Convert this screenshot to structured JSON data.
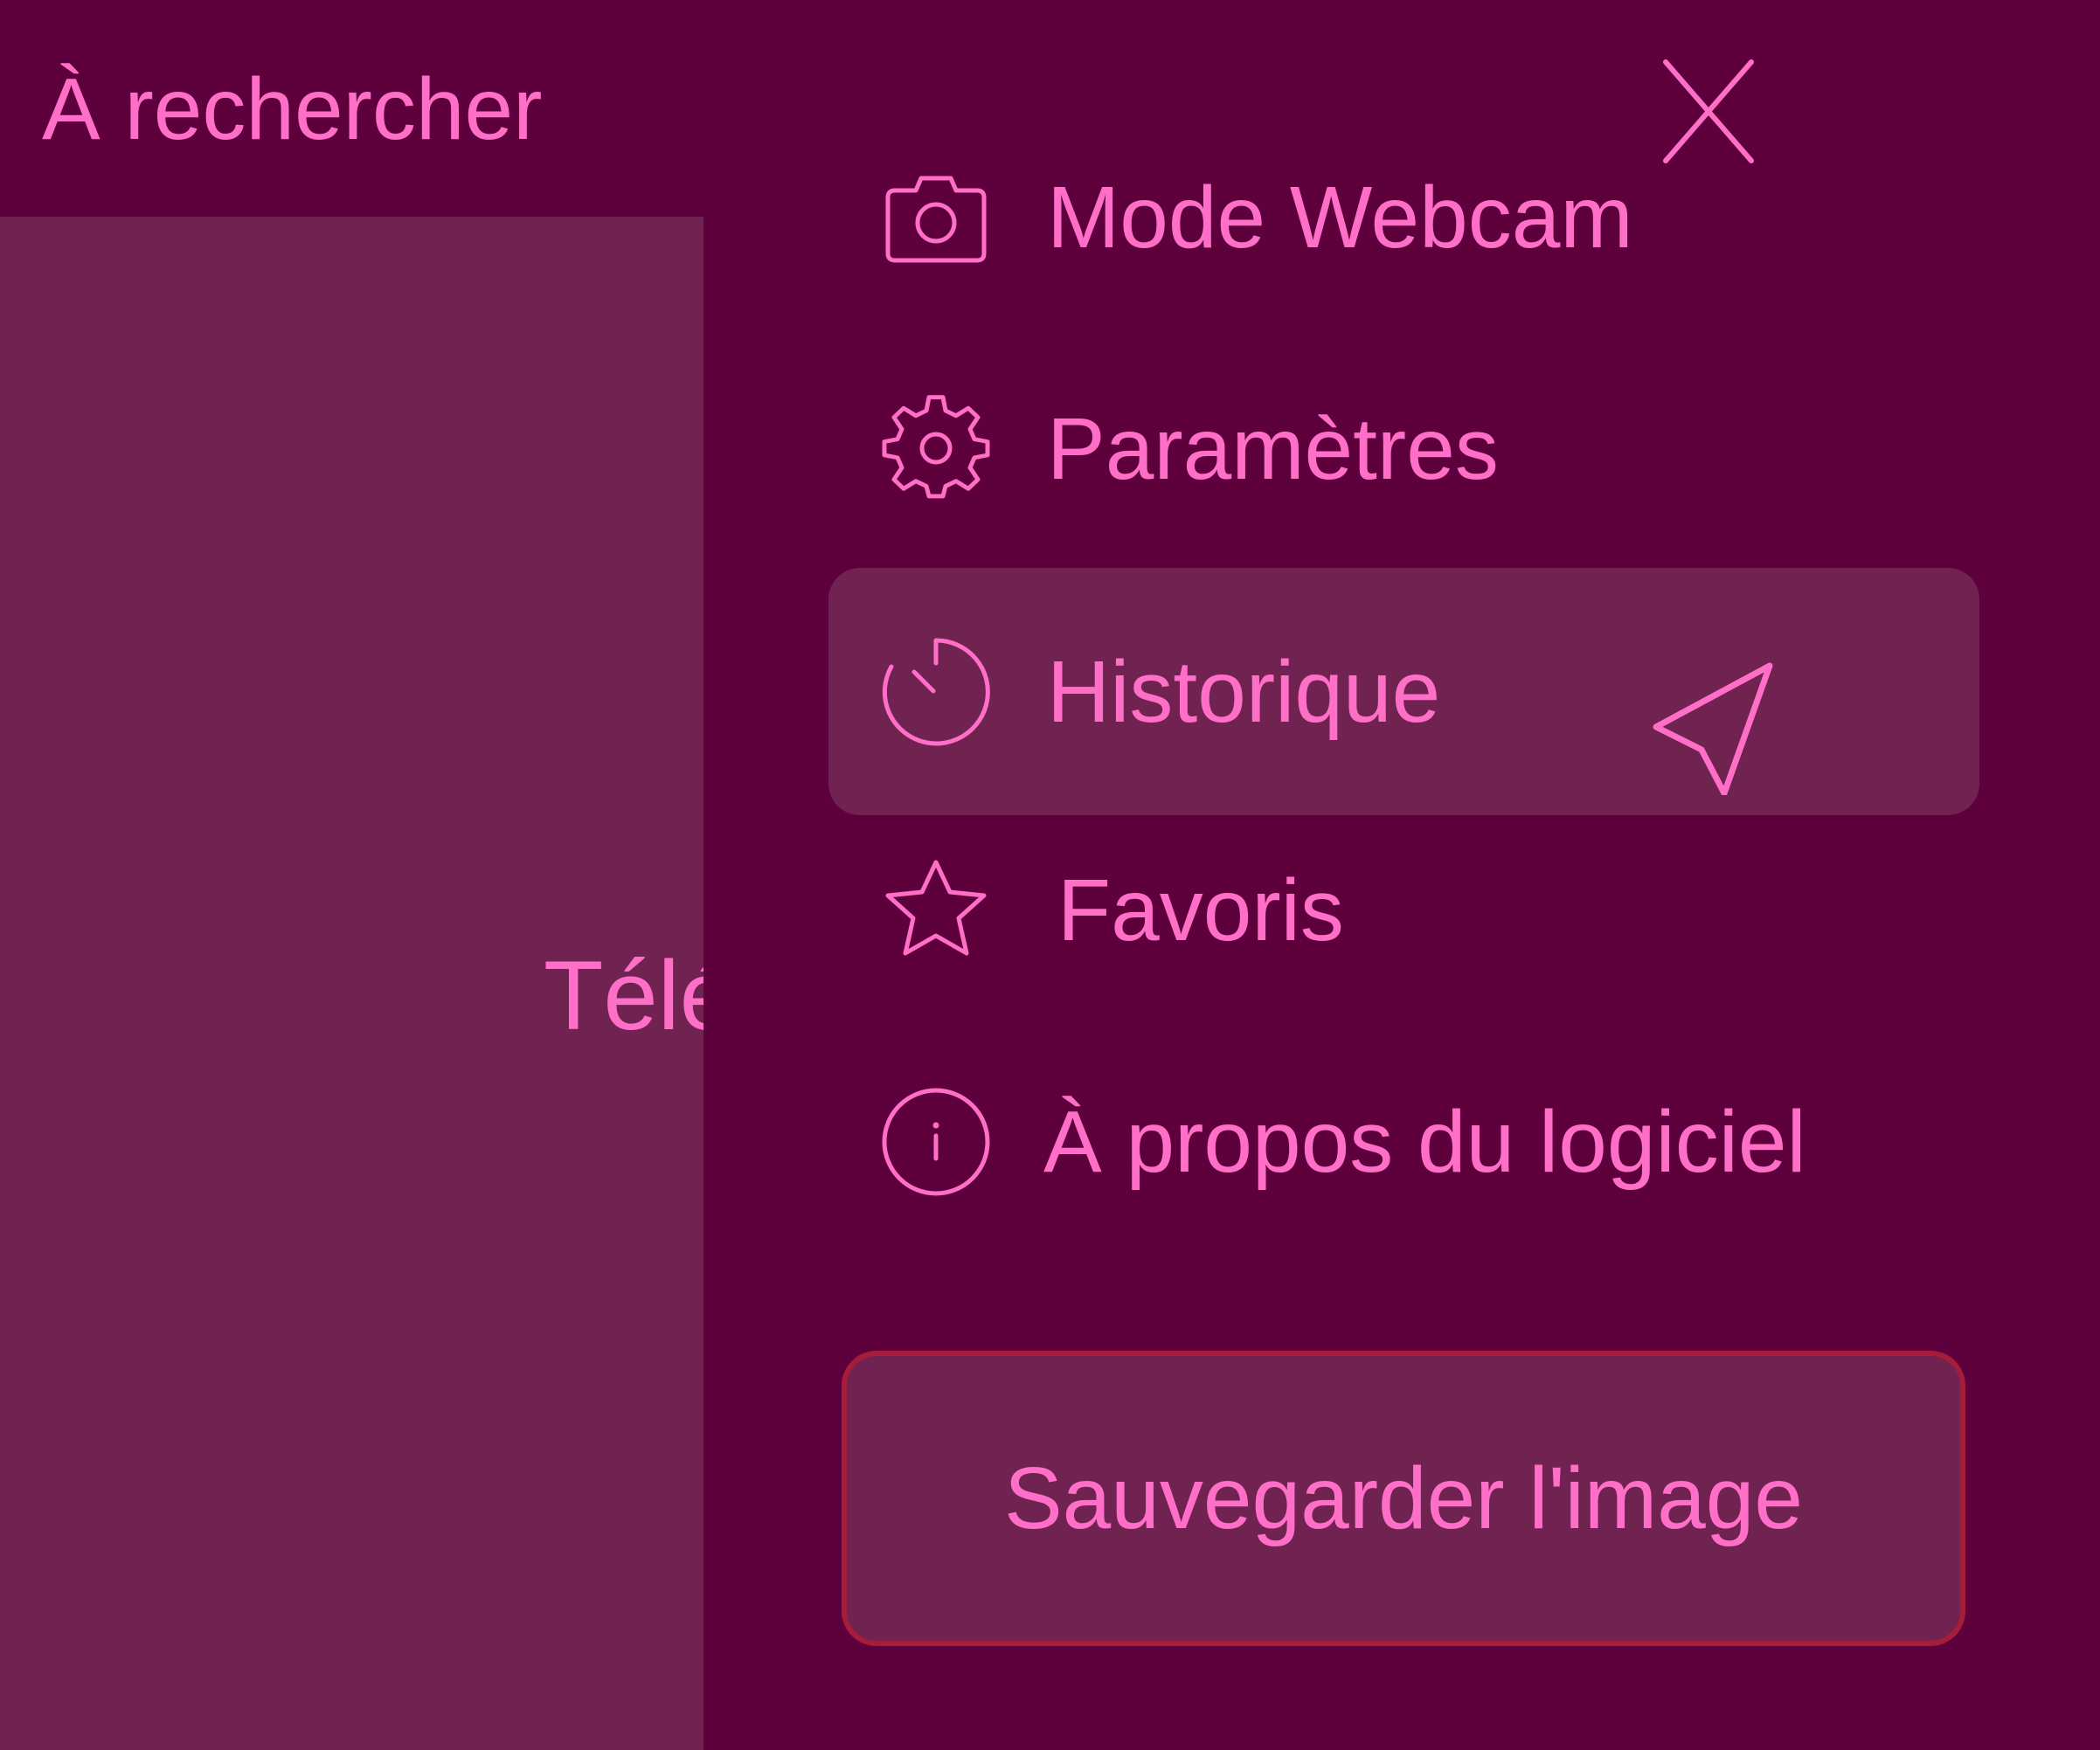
{
  "app": {
    "title": "À rechercher",
    "body_text": "Télé"
  },
  "drawer": {
    "close_label": "×",
    "items": [
      {
        "label": "Mode Webcam",
        "icon": "camera-icon",
        "active": false
      },
      {
        "label": "Paramètres",
        "icon": "gear-icon",
        "active": false
      },
      {
        "label": "Historique",
        "icon": "history-icon",
        "active": true
      },
      {
        "label": "Favoris",
        "icon": "star-icon",
        "active": false
      },
      {
        "label": "À propos du logiciel",
        "icon": "info-icon",
        "active": false
      }
    ],
    "save_button": "Sauvegarder l'image"
  },
  "colors": {
    "background": "#5e003c",
    "panel": "#702350",
    "accent": "#ff6ec7",
    "save_border": "#a51d3a"
  }
}
